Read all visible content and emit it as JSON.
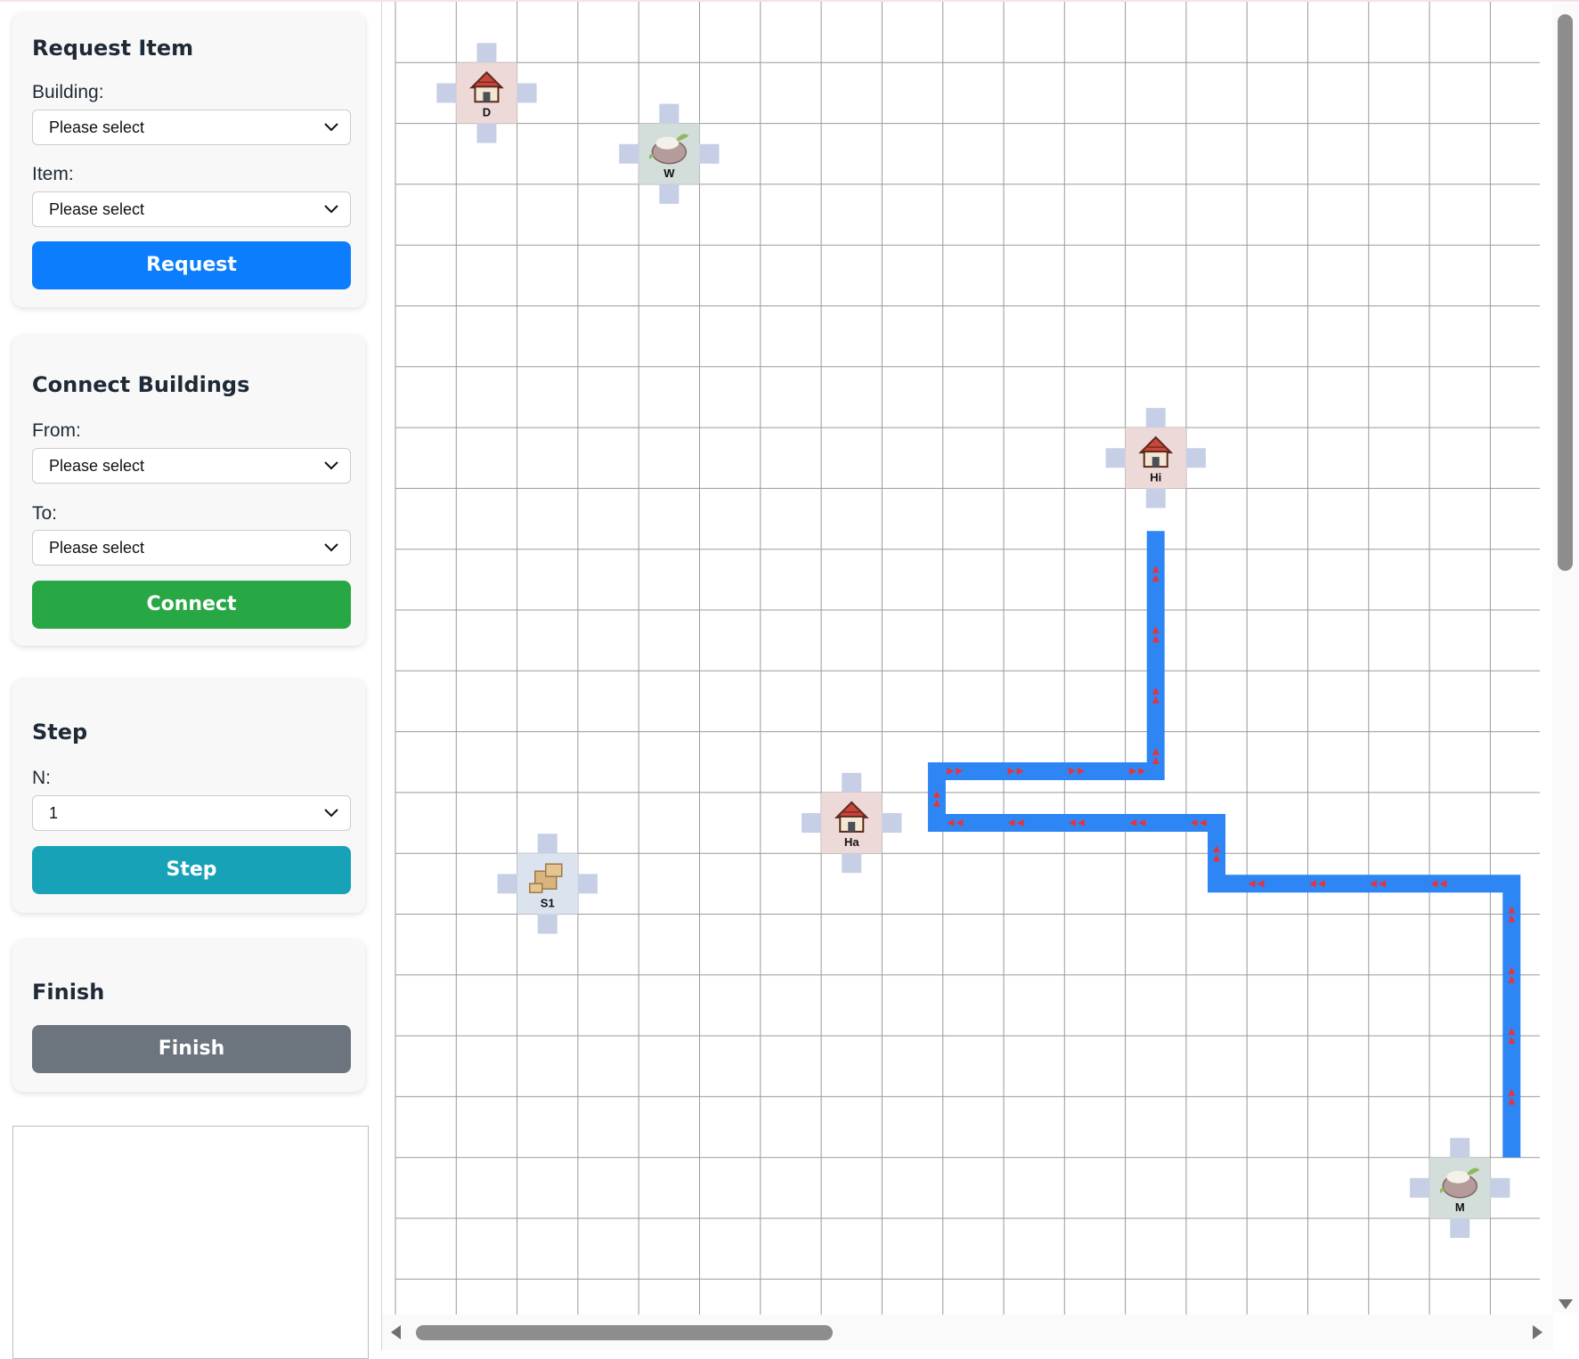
{
  "request_item": {
    "title": "Request Item",
    "building_label": "Building:",
    "building_value": "Please select",
    "item_label": "Item:",
    "item_value": "Please select",
    "button": "Request"
  },
  "connect_buildings": {
    "title": "Connect Buildings",
    "from_label": "From:",
    "from_value": "Please select",
    "to_label": "To:",
    "to_value": "Please select",
    "button": "Connect"
  },
  "step": {
    "title": "Step",
    "n_label": "N:",
    "n_value": "1",
    "button": "Step"
  },
  "finish": {
    "title": "Finish",
    "button": "Finish"
  },
  "colors": {
    "request": "#0b7dfd",
    "connect": "#28a745",
    "step": "#17a2b8",
    "finish": "#6c757d",
    "path": "#2e86f5",
    "arrow": "#e5343a",
    "house_tile": "#eed9d9",
    "farm_tile": "#d3ddd9",
    "storage_tile": "#dbe3ee",
    "port": "#c7cfe6"
  },
  "map": {
    "cols": 19,
    "rows": 22,
    "buildings": [
      {
        "label": "D",
        "icon": "house-icon",
        "col": 1,
        "row": 1
      },
      {
        "label": "W",
        "icon": "farm-icon",
        "col": 4,
        "row": 2
      },
      {
        "label": "Hi",
        "icon": "house-icon",
        "col": 12,
        "row": 7
      },
      {
        "label": "Ha",
        "icon": "house-icon",
        "col": 7,
        "row": 13
      },
      {
        "label": "S1",
        "icon": "box-icon",
        "col": 2,
        "row": 14
      },
      {
        "label": "M",
        "icon": "farm-icon",
        "col": 17,
        "row": 19
      }
    ]
  }
}
